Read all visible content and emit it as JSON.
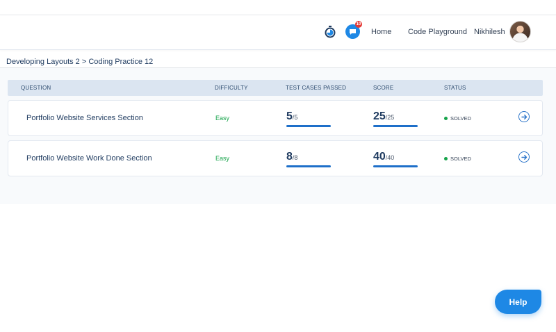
{
  "navbar": {
    "chat_badge": "10",
    "home": "Home",
    "playground": "Code Playground",
    "user_name": "Nikhilesh"
  },
  "breadcrumb": "Developing Layouts 2 > Coding Practice 12",
  "table": {
    "headers": [
      "QUESTION",
      "DIFFICULTY",
      "TEST CASES PASSED",
      "SCORE",
      "STATUS"
    ],
    "rows": [
      {
        "question": "Portfolio Website Services Section",
        "difficulty": "Easy",
        "passed": "5",
        "total": "/5",
        "passed_fraction": 1.0,
        "score": "25",
        "score_total": "/25",
        "score_fraction": 1.0,
        "status": "SOLVED"
      },
      {
        "question": "Portfolio Website Work Done Section",
        "difficulty": "Easy",
        "passed": "8",
        "total": "/8",
        "passed_fraction": 1.0,
        "score": "40",
        "score_total": "/40",
        "score_fraction": 1.0,
        "status": "SOLVED"
      }
    ]
  },
  "help_label": "Help",
  "colors": {
    "accent": "#1e88e5",
    "success": "#16a34a",
    "header_bg": "#dbe5f1"
  },
  "icons": [
    "timer-icon",
    "chat-icon",
    "arrow-right-circle-icon"
  ]
}
